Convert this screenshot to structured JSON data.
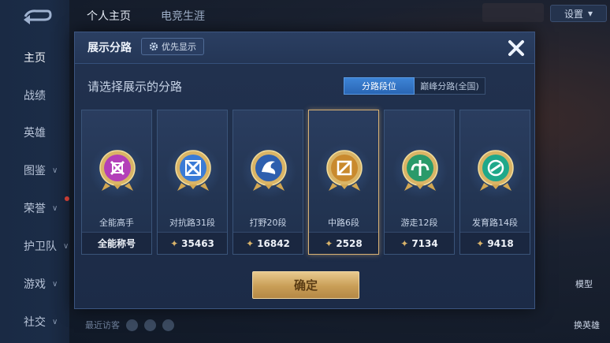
{
  "background": {
    "sidebar": {
      "items": [
        {
          "label": "主页",
          "has_chevron": false
        },
        {
          "label": "战绩",
          "has_chevron": false
        },
        {
          "label": "英雄",
          "has_chevron": false
        },
        {
          "label": "图鉴",
          "has_chevron": true
        },
        {
          "label": "荣誉",
          "has_chevron": true
        },
        {
          "label": "护卫队",
          "has_chevron": true
        },
        {
          "label": "游戏",
          "has_chevron": true
        },
        {
          "label": "社交",
          "has_chevron": true
        }
      ]
    },
    "top_tabs": [
      "个人主页",
      "电竞生涯"
    ],
    "settings_label": "设置",
    "recent_label": "最近访客",
    "right_buttons": [
      "模型",
      "换英雄"
    ]
  },
  "dialog": {
    "title": "展示分路",
    "priority_button": "优先显示",
    "prompt": "请选择展示的分路",
    "segments": [
      "分路段位",
      "巅峰分路(全国)"
    ],
    "active_segment": 0,
    "cards": [
      {
        "name": "全能高手",
        "value": "全能称号",
        "show_star": false,
        "color": "#b33fb8",
        "selected": false,
        "icon": "allround-emblem-icon"
      },
      {
        "name": "对抗路31段",
        "value": "35463",
        "show_star": true,
        "color": "#3a7bd6",
        "selected": false,
        "icon": "clash-lane-emblem-icon"
      },
      {
        "name": "打野20段",
        "value": "16842",
        "show_star": true,
        "color": "#2e5fae",
        "selected": false,
        "icon": "jungle-emblem-icon"
      },
      {
        "name": "中路6段",
        "value": "2528",
        "show_star": true,
        "color": "#c98a2e",
        "selected": true,
        "icon": "mid-lane-emblem-icon"
      },
      {
        "name": "游走12段",
        "value": "7134",
        "show_star": true,
        "color": "#2a9a6a",
        "selected": false,
        "icon": "roam-emblem-icon"
      },
      {
        "name": "发育路14段",
        "value": "9418",
        "show_star": true,
        "color": "#1fa88a",
        "selected": false,
        "icon": "farm-lane-emblem-icon"
      }
    ],
    "confirm_label": "确定",
    "accent_gold": "#d9b275"
  }
}
